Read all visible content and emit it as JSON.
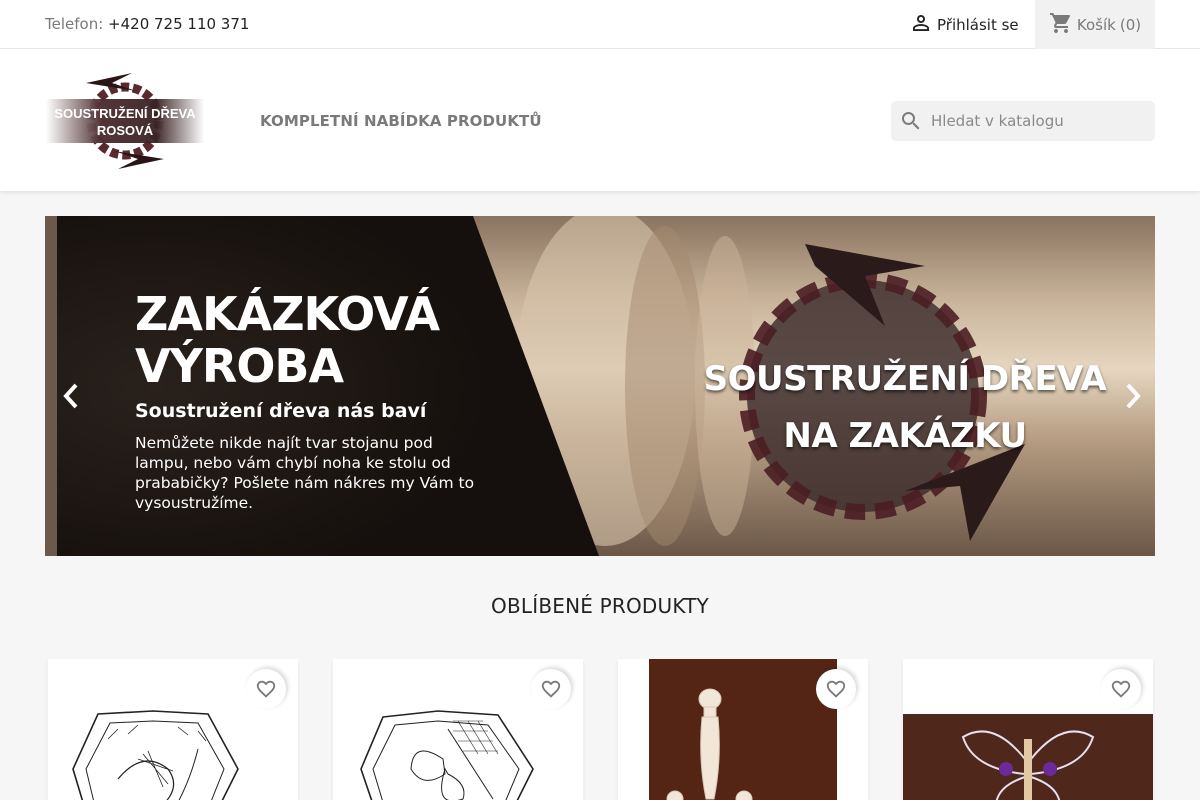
{
  "topbar": {
    "phone_label": "Telefon:",
    "phone_number": "+420 725 110 371",
    "login_label": "Přihlásit se",
    "cart_label": "Košík",
    "cart_count": "(0)"
  },
  "header": {
    "logo_line1": "SOUSTRUŽENÍ DŘEVA",
    "logo_line2": "ROSOVÁ",
    "nav_link": "KOMPLETNÍ NABÍDKA PRODUKTŮ",
    "search_placeholder": "Hledat v katalogu"
  },
  "slider": {
    "title": "ZAKÁZKOVÁ VÝROBA",
    "subtitle": "Soustružení dřeva nás baví",
    "description": "Nemůžete nikde najít tvar stojanu pod lampu, nebo vám chybí noha ke stolu od prababičky? Pošlete nám nákres my Vám to vysoustružíme.",
    "overlay_line1": "SOUSTRUŽENÍ DŘEVA",
    "overlay_line2": "NA ZAKÁZKU"
  },
  "products": {
    "section_title": "OBLÍBENÉ PRODUKTY",
    "items": [
      {
        "image": "lace-pattern-hexagon-icon"
      },
      {
        "image": "lace-pattern-butterfly-icon"
      },
      {
        "image": "wooden-bobbins-icon"
      },
      {
        "image": "lace-butterfly-photo-icon"
      }
    ]
  },
  "colors": {
    "accent": "#24b9d7",
    "text": "#232323",
    "muted": "#7a7a7a",
    "background": "#f6f6f6"
  },
  "icons": {
    "login": "person-icon",
    "cart": "shopping-cart-icon",
    "search": "search-icon",
    "favorite": "heart-outline-icon",
    "prev": "chevron-left-icon",
    "next": "chevron-right-icon"
  }
}
